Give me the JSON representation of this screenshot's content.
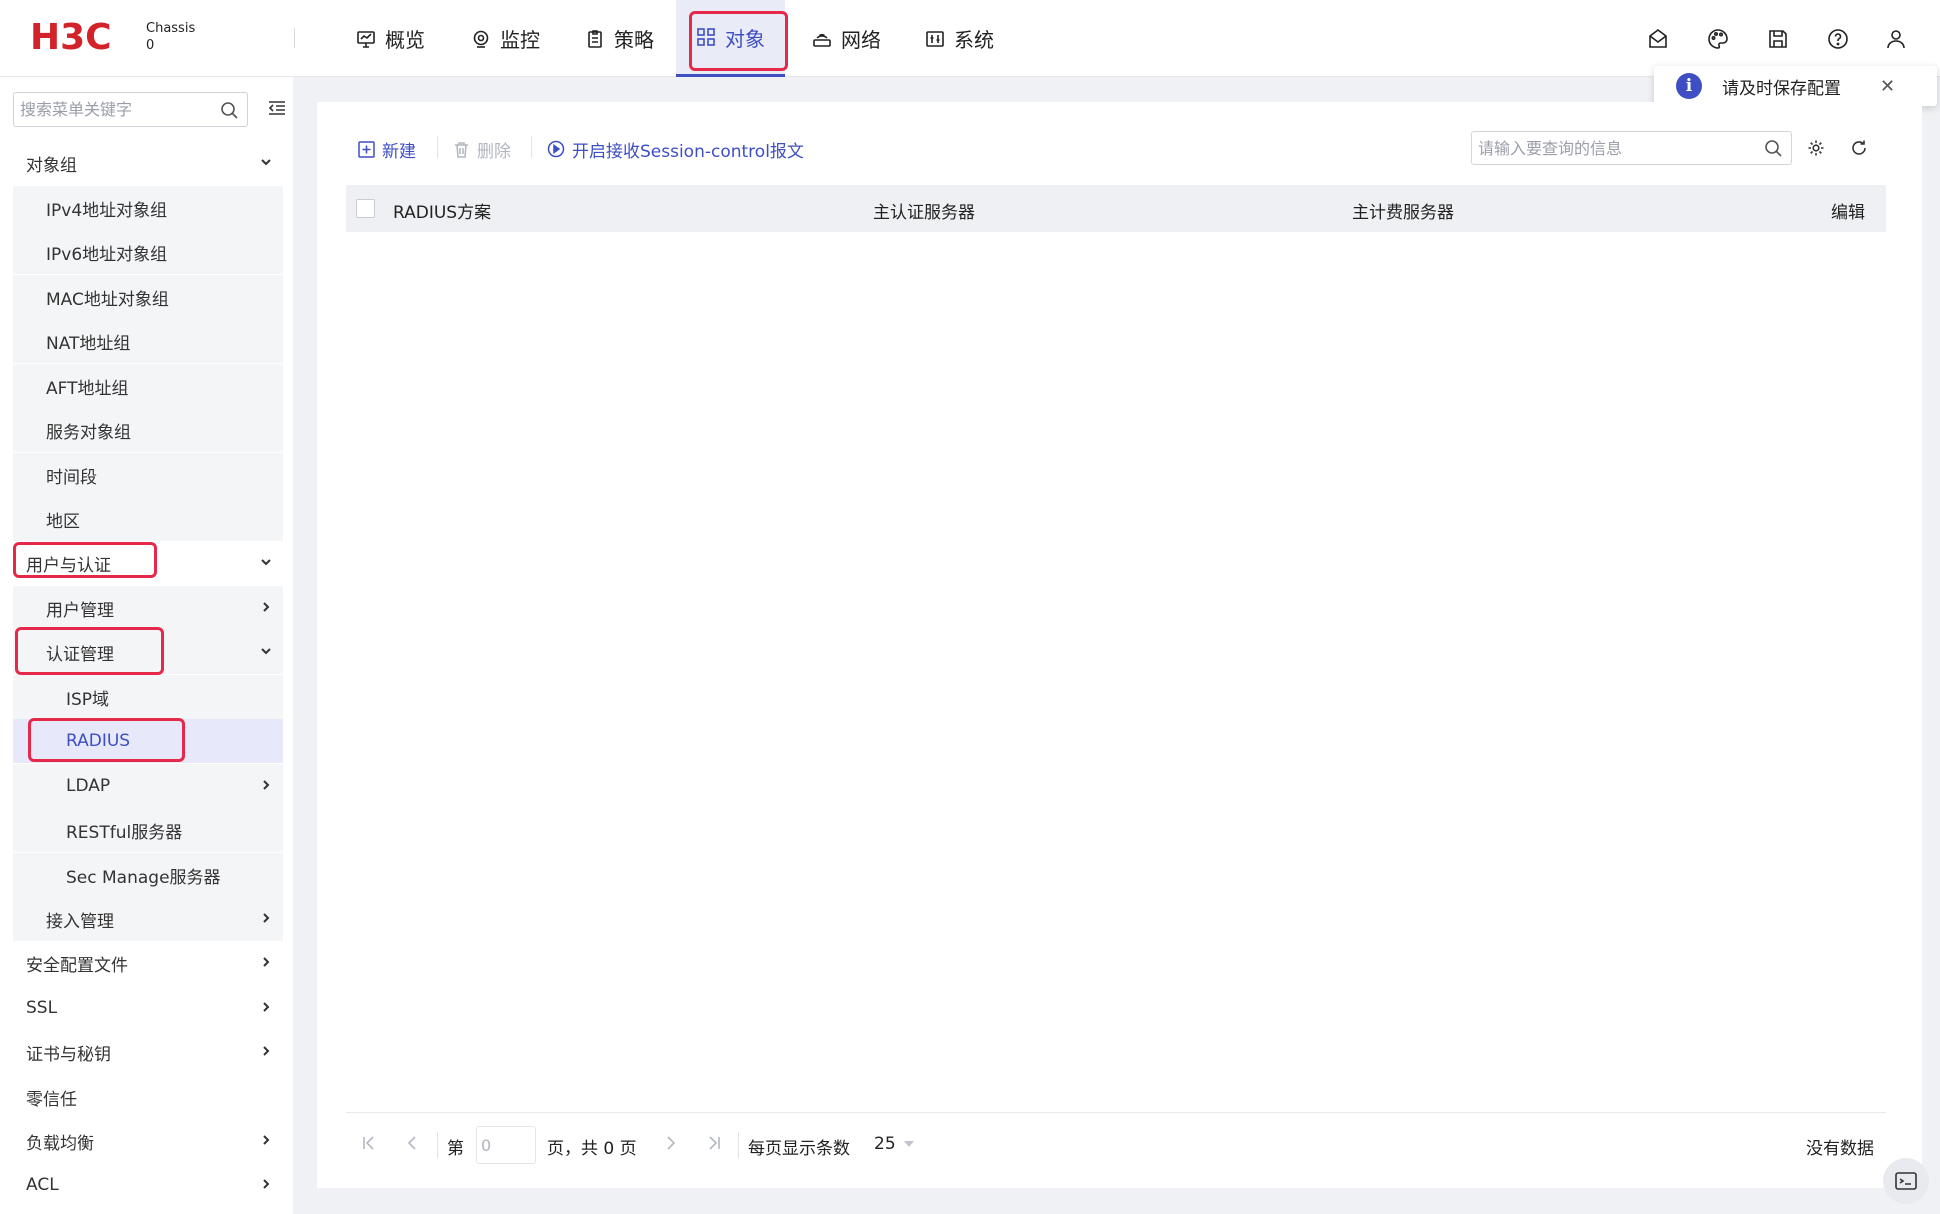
{
  "header": {
    "brand": "H3C",
    "chassis_line1": "Chassis",
    "chassis_line2": "0",
    "tabs": [
      {
        "label": "概览",
        "icon": "monitor-chart-icon"
      },
      {
        "label": "监控",
        "icon": "location-eye-icon"
      },
      {
        "label": "策略",
        "icon": "clipboard-icon"
      },
      {
        "label": "对象",
        "icon": "grid-icon"
      },
      {
        "label": "网络",
        "icon": "router-icon"
      },
      {
        "label": "系统",
        "icon": "system-panel-icon"
      }
    ],
    "active_tab": "对象",
    "icons": [
      "mail-icon",
      "palette-icon",
      "save-icon",
      "help-icon",
      "user-icon"
    ]
  },
  "toast": {
    "message": "请及时保存配置"
  },
  "sidebar": {
    "search_placeholder": "搜索菜单关键字",
    "menu": [
      {
        "label": "对象组"
      },
      {
        "label": "IPv4地址对象组"
      },
      {
        "label": "IPv6地址对象组"
      },
      {
        "label": "MAC地址对象组"
      },
      {
        "label": "NAT地址组"
      },
      {
        "label": "AFT地址组"
      },
      {
        "label": "服务对象组"
      },
      {
        "label": "时间段"
      },
      {
        "label": "地区"
      },
      {
        "label": "用户与认证"
      },
      {
        "label": "用户管理"
      },
      {
        "label": "认证管理"
      },
      {
        "label": "ISP域"
      },
      {
        "label": "RADIUS"
      },
      {
        "label": "LDAP"
      },
      {
        "label": "RESTful服务器"
      },
      {
        "label": "Sec Manage服务器"
      },
      {
        "label": "接入管理"
      },
      {
        "label": "安全配置文件"
      },
      {
        "label": "SSL"
      },
      {
        "label": "证书与秘钥"
      },
      {
        "label": "零信任"
      },
      {
        "label": "负载均衡"
      },
      {
        "label": "ACL"
      }
    ]
  },
  "toolbar": {
    "new_label": "新建",
    "delete_label": "删除",
    "session_label": "开启接收Session-control报文",
    "query_placeholder": "请输入要查询的信息"
  },
  "table": {
    "columns": [
      "RADIUS方案",
      "主认证服务器",
      "主计费服务器",
      "编辑"
    ],
    "rows": []
  },
  "pager": {
    "prefix": "第",
    "page_placeholder": "0",
    "suffix": "页，共 0 页",
    "per_page_label": "每页显示条数",
    "per_page_value": "25",
    "empty_text": "没有数据"
  }
}
